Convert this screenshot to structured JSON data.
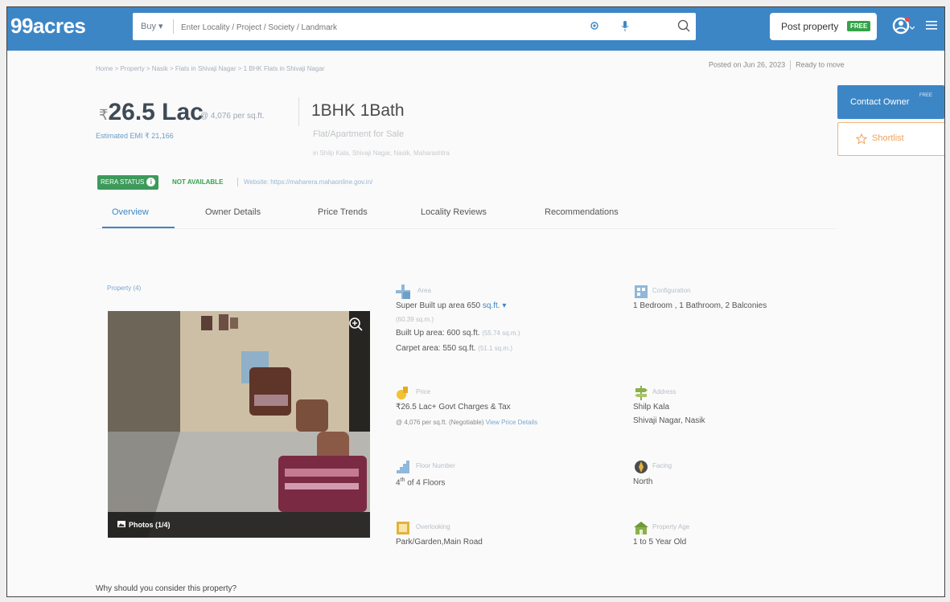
{
  "brand": {
    "logo": "99acres",
    "accent": "#3d86c6"
  },
  "search": {
    "mode": "Buy",
    "placeholder": "Enter Locality / Project / Society / Landmark"
  },
  "header": {
    "post_property": "Post property",
    "free_badge": "FREE"
  },
  "breadcrumb": "Home > Property > Nasik > Flats in Shivaji Nagar > 1 BHK Flats in Shivaji Nagar",
  "posted": {
    "date": "Posted on Jun 26, 2023",
    "status": "Ready to move"
  },
  "price": {
    "symbol": "₹",
    "amount": "26.5 Lac",
    "per_sqft": "@ 4,076 per sq.ft.",
    "emi": "Estimated EMI ₹ 21,166"
  },
  "listing": {
    "title": "1BHK 1Bath",
    "subtitle": "Flat/Apartment for Sale",
    "address": "in Shilp Kala, Shivaji Nagar, Nasik, Maharashtra"
  },
  "actions": {
    "contact": "Contact Owner",
    "contact_badge": "FREE",
    "shortlist": "Shortlist"
  },
  "rera": {
    "label": "RERA STATUS",
    "info": "i",
    "status": "NOT AVAILABLE",
    "website": "Website: https://maharera.mahaonline.gov.in/"
  },
  "tabs": [
    {
      "label": "Overview"
    },
    {
      "label": "Owner Details"
    },
    {
      "label": "Price Trends"
    },
    {
      "label": "Locality Reviews"
    },
    {
      "label": "Recommendations"
    }
  ],
  "gallery": {
    "count": "Property (4)",
    "photos": "Photos (1/4)"
  },
  "details": {
    "area": {
      "label": "Area",
      "super": "Super Built up area 650",
      "unit": "sq.ft.",
      "approx": "(60.39 sq.m.)",
      "built": "Built Up area: 600 sq.ft.",
      "built_approx": "(55.74 sq.m.)",
      "carpet": "Carpet area: 550 sq.ft.",
      "carpet_approx": "(51.1 sq.m.)"
    },
    "config": {
      "label": "Configuration",
      "value": "1 Bedroom , 1 Bathroom, 2 Balconies"
    },
    "price": {
      "label": "Price",
      "value": "₹26.5 Lac+ Govt Charges & Tax",
      "per": "@ 4,076 per sq.ft.",
      "negotiable": "(Negotiable)",
      "view": "View Price Details"
    },
    "address": {
      "label": "Address",
      "line1": "Shilp Kala",
      "line2": "Shivaji Nagar, Nasik"
    },
    "floor": {
      "label": "Floor Number",
      "value": "4",
      "sup": "th",
      "of": "of 4 Floors"
    },
    "facing": {
      "label": "Facing",
      "value": "North"
    },
    "overlooking": {
      "label": "Overlooking",
      "value": "Park/Garden,Main Road"
    },
    "age": {
      "label": "Property Age",
      "value": "1 to 5 Year Old"
    }
  },
  "why": "Why should you consider this property?"
}
